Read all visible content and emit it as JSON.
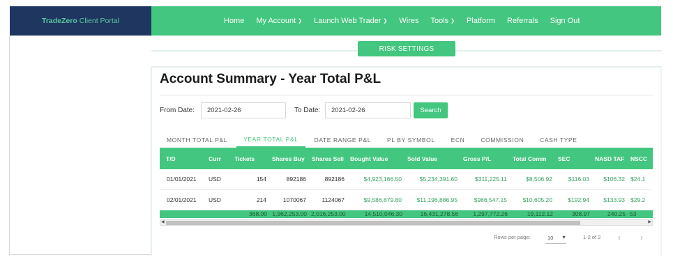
{
  "brand": {
    "name": "TradeZero",
    "suffix": "Client Portal"
  },
  "nav": [
    {
      "label": "Home",
      "dropdown": false
    },
    {
      "label": "My Account",
      "dropdown": true
    },
    {
      "label": "Launch Web Trader",
      "dropdown": true
    },
    {
      "label": "Wires",
      "dropdown": false
    },
    {
      "label": "Tools",
      "dropdown": true
    },
    {
      "label": "Platform",
      "dropdown": false
    },
    {
      "label": "Referrals",
      "dropdown": false
    },
    {
      "label": "Sign Out",
      "dropdown": false
    }
  ],
  "risk_button": "RISK SETTINGS",
  "title": "Account Summary - Year Total P&L",
  "filters": {
    "from_label": "From Date:",
    "from_value": "2021-02-26",
    "to_label": "To Date:",
    "to_value": "2021-02-26",
    "search_label": "Search"
  },
  "tabs": [
    {
      "label": "MONTH TOTAL P&L",
      "active": false
    },
    {
      "label": "YEAR TOTAL P&L",
      "active": true
    },
    {
      "label": "DATE RANGE P&L",
      "active": false
    },
    {
      "label": "PL BY SYMBOL",
      "active": false
    },
    {
      "label": "ECN",
      "active": false
    },
    {
      "label": "COMMISSION",
      "active": false
    },
    {
      "label": "CASH TYPE",
      "active": false
    }
  ],
  "table": {
    "columns": [
      "T/D",
      "Curr",
      "Tickets",
      "Shares Buy",
      "Shares Sell",
      "Bought Value",
      "Sold Value",
      "Gross P/L",
      "Total Comm",
      "SEC",
      "NASD TAF",
      "NSCC"
    ],
    "rows": [
      [
        "01/01/2021",
        "USD",
        "154",
        "892186",
        "892186",
        "$4,923,166.50",
        "$5,234,391.60",
        "$311,225.11",
        "$8,506.92",
        "$116.03",
        "$106.32",
        "$24.1"
      ],
      [
        "02/01/2021",
        "USD",
        "214",
        "1070067",
        "1124067",
        "$9,586,879.80",
        "$11,196,886.95",
        "$986,547.15",
        "$10,605.20",
        "$192.94",
        "$133.93",
        "$29.2"
      ]
    ],
    "totals": [
      "",
      "",
      "368.00",
      "1,962,253.00",
      "2,016,253.00",
      "14,510,046.30",
      "16,431,278.56",
      "1,297,772.26",
      "19,112.12",
      "308.97",
      "240.25",
      "53"
    ]
  },
  "pager": {
    "rows_label": "Rows per page:",
    "rows_value": "10",
    "range": "1-2 of 2"
  },
  "colors": {
    "accent": "#43c67f",
    "brand_bg": "#1e3660"
  }
}
